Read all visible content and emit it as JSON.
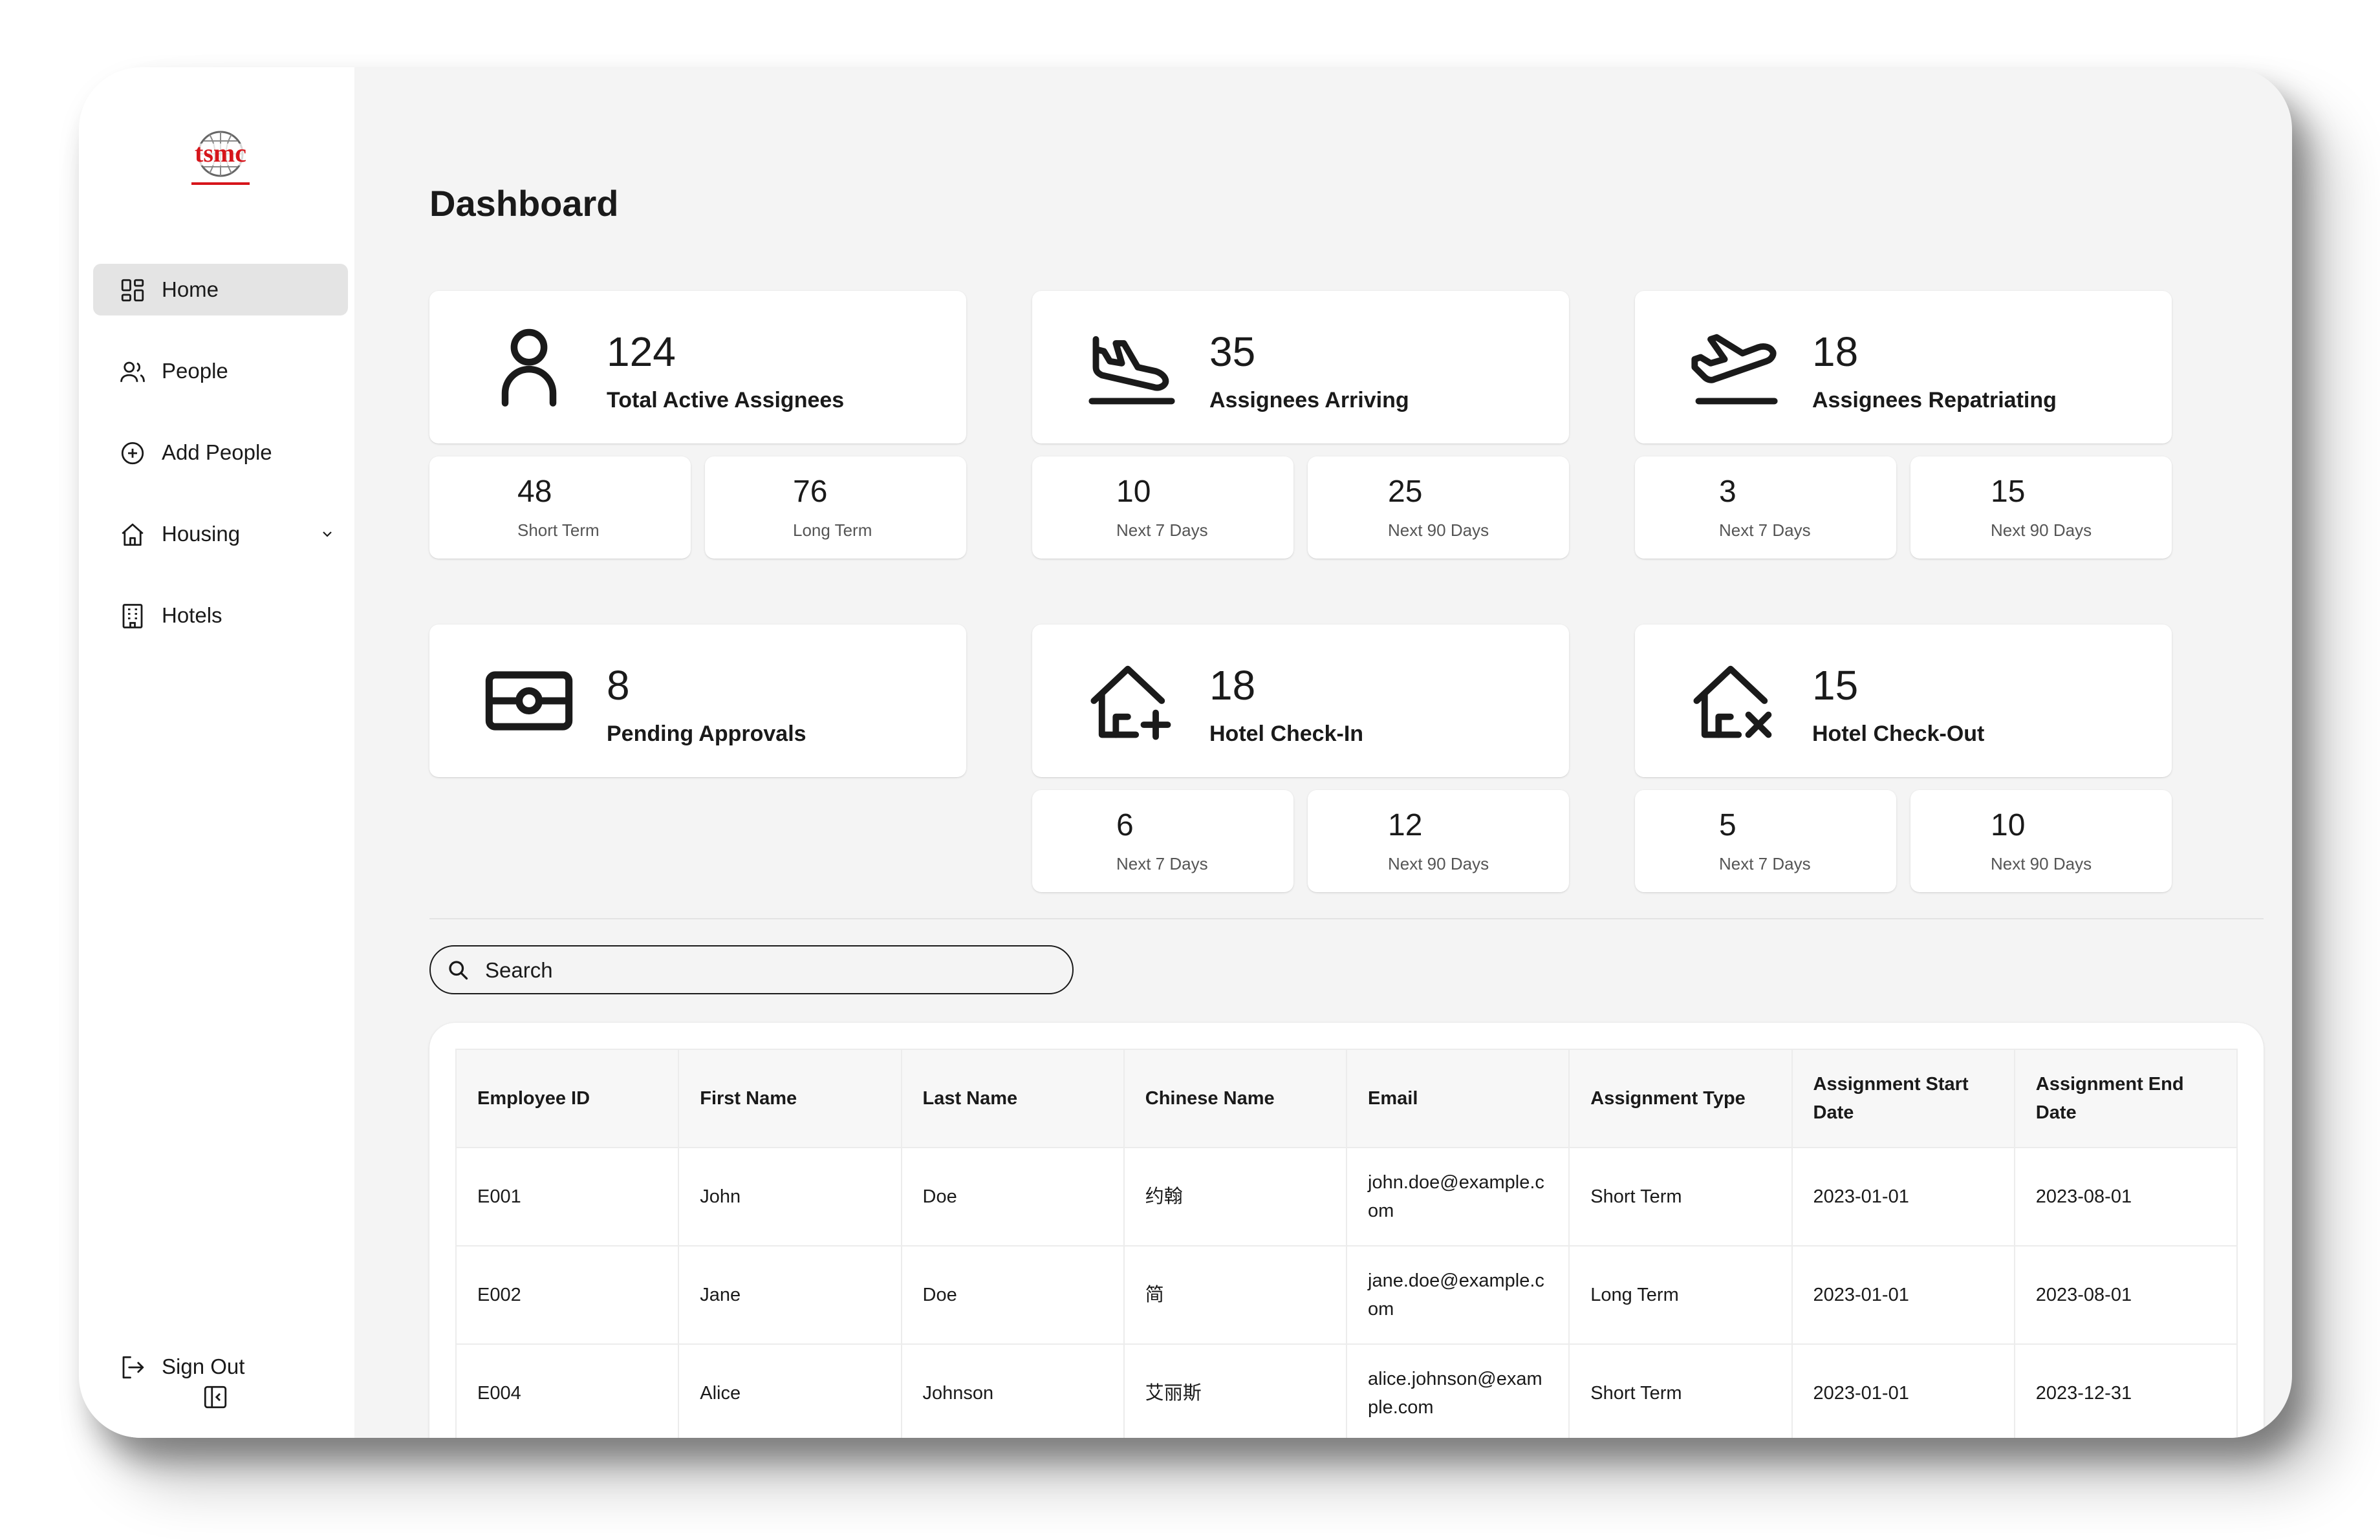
{
  "brand": {
    "logo_text": "tsmc",
    "logo_color": "#d6151b"
  },
  "sidebar": {
    "items": [
      {
        "label": "Home",
        "icon": "dashboard-icon",
        "active": true
      },
      {
        "label": "People",
        "icon": "users-icon"
      },
      {
        "label": "Add People",
        "icon": "plus-circle-icon"
      },
      {
        "label": "Housing",
        "icon": "house-icon",
        "expandable": true
      },
      {
        "label": "Hotels",
        "icon": "building-icon"
      }
    ],
    "sign_out": {
      "label": "Sign Out",
      "icon": "sign-out-icon"
    },
    "collapse_icon": "sidebar-collapse-icon"
  },
  "page": {
    "title": "Dashboard"
  },
  "stats": {
    "active": {
      "value": "124",
      "label": "Total Active Assignees",
      "icon": "person-icon",
      "sub": [
        {
          "value": "48",
          "label": "Short Term"
        },
        {
          "value": "76",
          "label": "Long Term"
        }
      ]
    },
    "arriving": {
      "value": "35",
      "label": "Assignees Arriving",
      "icon": "plane-landing-icon",
      "sub": [
        {
          "value": "10",
          "label": "Next 7 Days"
        },
        {
          "value": "25",
          "label": "Next 90 Days"
        }
      ]
    },
    "repatriating": {
      "value": "18",
      "label": "Assignees Repatriating",
      "icon": "plane-takeoff-icon",
      "sub": [
        {
          "value": "3",
          "label": "Next 7 Days"
        },
        {
          "value": "15",
          "label": "Next 90 Days"
        }
      ]
    },
    "pending": {
      "value": "8",
      "label": "Pending Approvals",
      "icon": "cash-icon"
    },
    "checkin": {
      "value": "18",
      "label": "Hotel Check-In",
      "icon": "house-plus-icon",
      "sub": [
        {
          "value": "6",
          "label": "Next 7 Days"
        },
        {
          "value": "12",
          "label": "Next 90 Days"
        }
      ]
    },
    "checkout": {
      "value": "15",
      "label": "Hotel Check-Out",
      "icon": "house-x-icon",
      "sub": [
        {
          "value": "5",
          "label": "Next 7 Days"
        },
        {
          "value": "10",
          "label": "Next 90 Days"
        }
      ]
    }
  },
  "search": {
    "placeholder": "Search"
  },
  "table": {
    "headers": [
      "Employee ID",
      "First Name",
      "Last Name",
      "Chinese Name",
      "Email",
      "Assignment Type",
      "Assignment Start Date",
      "Assignment End Date"
    ],
    "rows": [
      [
        "E001",
        "John",
        "Doe",
        "约翰",
        "john.doe@example.com",
        "Short Term",
        "2023-01-01",
        "2023-08-01"
      ],
      [
        "E002",
        "Jane",
        "Doe",
        "简",
        "jane.doe@example.com",
        "Long Term",
        "2023-01-01",
        "2023-08-01"
      ],
      [
        "E004",
        "Alice",
        "Johnson",
        "艾丽斯",
        "alice.johnson@example.com",
        "Short Term",
        "2023-01-01",
        "2023-12-31"
      ]
    ]
  }
}
